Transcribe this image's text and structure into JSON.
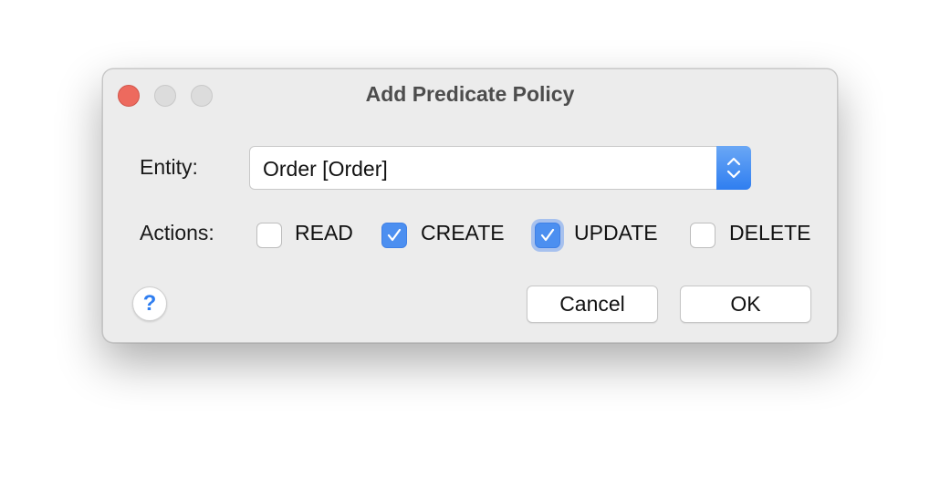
{
  "window": {
    "title": "Add Predicate Policy",
    "traffic_lights": [
      "close",
      "minimize",
      "zoom"
    ]
  },
  "form": {
    "entity_label": "Entity:",
    "entity_value": "Order [Order]",
    "actions_label": "Actions:",
    "actions": [
      {
        "label": "READ",
        "checked": false
      },
      {
        "label": "CREATE",
        "checked": true
      },
      {
        "label": "UPDATE",
        "checked": true,
        "focused": true
      },
      {
        "label": "DELETE",
        "checked": false
      }
    ]
  },
  "footer": {
    "help_icon": "?",
    "cancel_label": "Cancel",
    "ok_label": "OK"
  },
  "colors": {
    "accent": "#2f7ef0",
    "close": "#ed6a5e",
    "checkbox_on": "#4c8ff0"
  }
}
